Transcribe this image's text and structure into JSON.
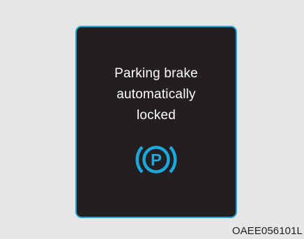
{
  "display": {
    "message_lines": [
      "Parking brake",
      "automatically",
      "locked"
    ],
    "indicator_icon": "parking-brake-icon",
    "indicator_letter": "P",
    "indicator_color": "#1ba8dc",
    "border_color": "#1ba8dc",
    "screen_color": "#231f20",
    "text_color": "#ffffff"
  },
  "image_code": "OAEE056101L"
}
